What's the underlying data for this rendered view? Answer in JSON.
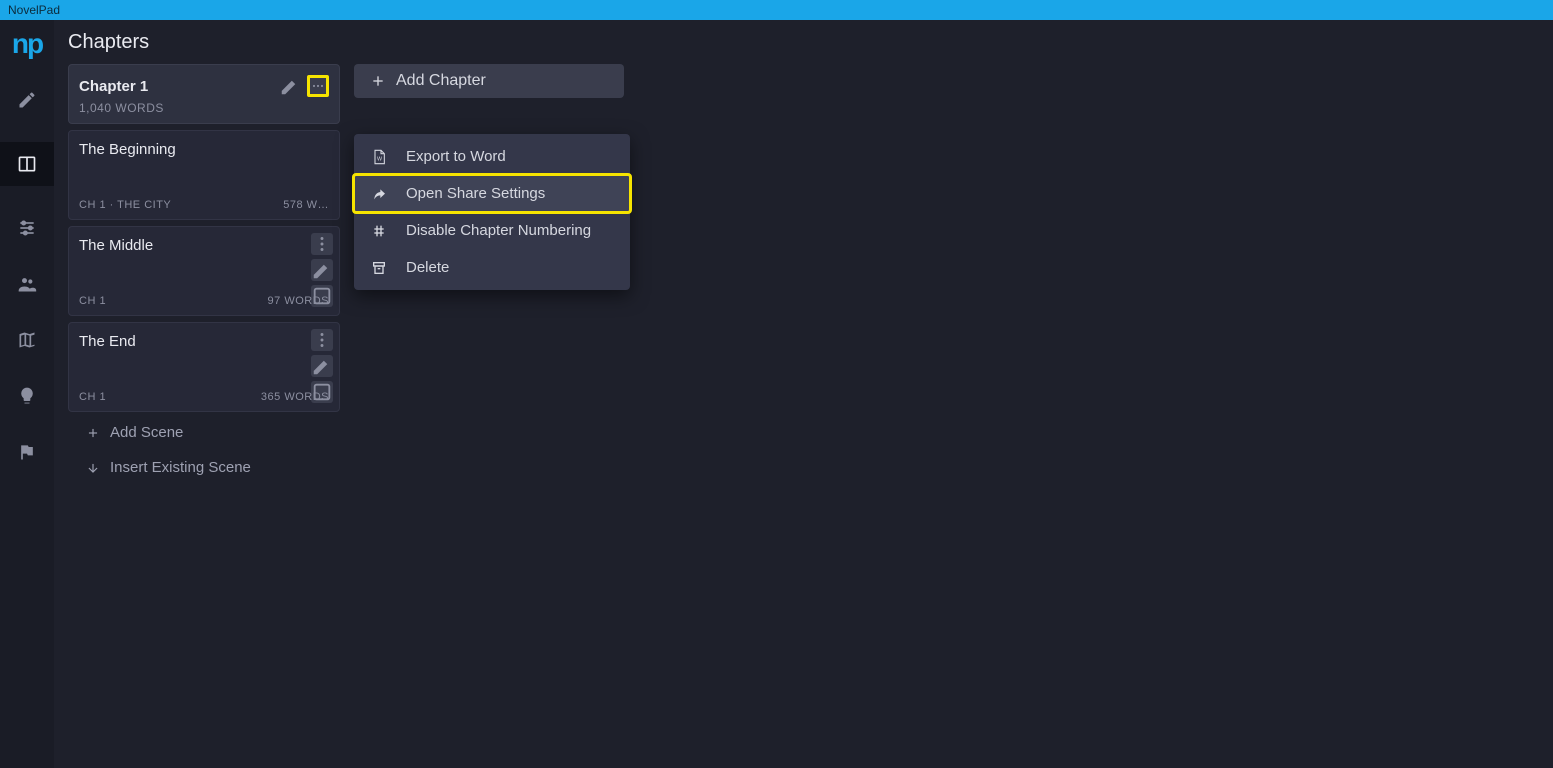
{
  "titlebar": {
    "appname": "NovelPad"
  },
  "header": {
    "title": "Chapters"
  },
  "rail": {
    "logo": "np"
  },
  "chapter": {
    "title": "Chapter 1",
    "words": "1,040 WORDS"
  },
  "scenes": [
    {
      "title": "The Beginning",
      "left": "CH 1 · THE CITY",
      "right": "578 W…"
    },
    {
      "title": "The Middle",
      "left": "CH 1",
      "right": "97 WORDS"
    },
    {
      "title": "The End",
      "left": "CH 1",
      "right": "365 WORDS"
    }
  ],
  "actions": {
    "add_scene": "Add Scene",
    "insert_existing": "Insert Existing Scene",
    "add_chapter": "Add Chapter"
  },
  "context_menu": {
    "export": "Export to Word",
    "share": "Open Share Settings",
    "disable_num": "Disable Chapter Numbering",
    "delete": "Delete"
  }
}
